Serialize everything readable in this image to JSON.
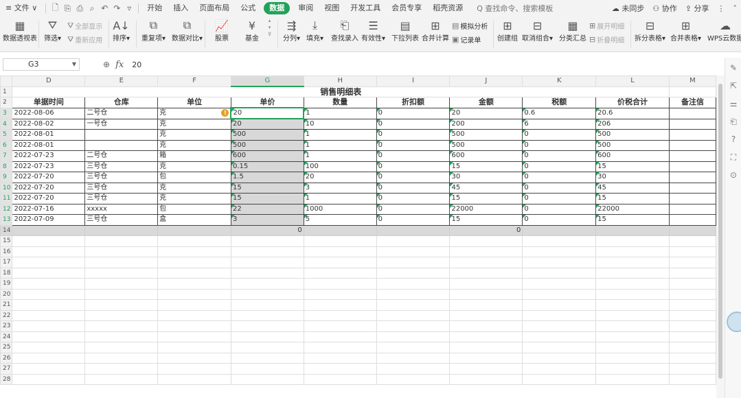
{
  "menubar": {
    "file": "≡ 文件 ∨",
    "tabs": [
      "开始",
      "插入",
      "页面布局",
      "公式",
      "数据",
      "审阅",
      "视图",
      "开发工具",
      "会员专享",
      "稻壳资源"
    ],
    "active_tab": "数据",
    "search_text": "Q 查找命令、搜索模板",
    "right": [
      "未同步",
      "协作",
      "分享"
    ]
  },
  "ribbon": {
    "pivot": "数据透视表",
    "filter": "筛选",
    "show_all": "全部显示",
    "reapply": "重新应用",
    "sort": "排序",
    "duplicates": "重复项",
    "compare": "数据对比",
    "stock": "股票",
    "fund": "基金",
    "split_col": "分列",
    "fill": "填充",
    "lookup_entry": "查找录入",
    "validity": "有效性",
    "dropdown_list": "下拉列表",
    "consolidate": "合并计算",
    "simulate": "模拟分析",
    "record_sheet": "记录单",
    "create_group": "创建组",
    "ungroup": "取消组合",
    "subtotal": "分类汇总",
    "expand_detail": "展开明细",
    "collapse_detail": "折叠明细",
    "split_table": "拆分表格",
    "merge_table": "合并表格",
    "wps_cloud": "WPS云数据"
  },
  "formula_bar": {
    "cell_ref": "G3",
    "formula_value": "20"
  },
  "sheet": {
    "columns": [
      "D",
      "E",
      "F",
      "G",
      "H",
      "I",
      "J",
      "K",
      "L",
      "M"
    ],
    "title": "销售明细表",
    "headers": [
      "单据时间",
      "仓库",
      "单位",
      "单价",
      "数量",
      "折扣额",
      "金额",
      "税额",
      "价税合计",
      "备注信"
    ],
    "rows": [
      [
        "2022-08-06",
        "二号仓",
        "克",
        "20",
        "1",
        "0",
        "20",
        "0.6",
        "20.6",
        ""
      ],
      [
        "2022-08-02",
        "一号仓",
        "克",
        "20",
        "10",
        "0",
        "200",
        "6",
        "206",
        ""
      ],
      [
        "2022-08-01",
        "",
        "克",
        "500",
        "1",
        "0",
        "500",
        "0",
        "500",
        ""
      ],
      [
        "2022-08-01",
        "",
        "克",
        "500",
        "1",
        "0",
        "500",
        "0",
        "500",
        ""
      ],
      [
        "2022-07-23",
        "二号仓",
        "箱",
        "600",
        "1",
        "0",
        "600",
        "0",
        "600",
        ""
      ],
      [
        "2022-07-23",
        "三号仓",
        "克",
        "0.15",
        "100",
        "0",
        "15",
        "0",
        "15",
        ""
      ],
      [
        "2022-07-20",
        "三号仓",
        "包",
        "1.5",
        "20",
        "0",
        "30",
        "0",
        "30",
        ""
      ],
      [
        "2022-07-20",
        "三号仓",
        "克",
        "15",
        "3",
        "0",
        "45",
        "0",
        "45",
        ""
      ],
      [
        "2022-07-20",
        "三号仓",
        "克",
        "15",
        "1",
        "0",
        "15",
        "0",
        "15",
        ""
      ],
      [
        "2022-07-16",
        "xxxxx",
        "包",
        "22",
        "1000",
        "0",
        "22000",
        "0",
        "22000",
        ""
      ],
      [
        "2022-07-09",
        "三号仓",
        "盒",
        "3",
        "5",
        "0",
        "15",
        "0",
        "15",
        ""
      ]
    ],
    "totals": [
      "",
      "",
      "",
      "0",
      "",
      "",
      "0",
      "",
      "",
      ""
    ],
    "row_numbers": [
      "1",
      "2",
      "3",
      "4",
      "5",
      "6",
      "7",
      "8",
      "9",
      "10",
      "11",
      "12",
      "13",
      "14",
      "15",
      "16",
      "17",
      "18",
      "19",
      "20",
      "21",
      "22",
      "23",
      "24",
      "25",
      "26",
      "27",
      "28"
    ]
  },
  "colors": {
    "accent": "#22a15a",
    "selection_fill": "#d8d8d8",
    "warning": "#e6a020"
  }
}
